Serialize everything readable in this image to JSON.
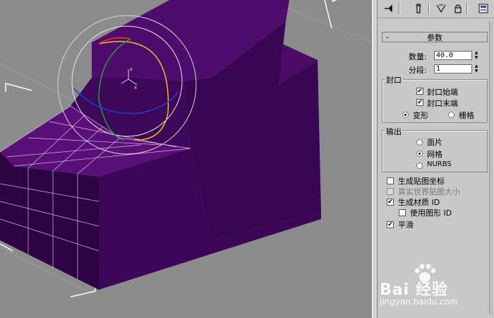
{
  "toolbar": {
    "icons": [
      "pin-icon",
      "stack-icon",
      "funnel-icon",
      "lock-icon",
      "configure-icon"
    ]
  },
  "rollout": {
    "collapse_symbol": "-",
    "title": "参数"
  },
  "params": {
    "amount_label": "数量:",
    "amount_value": "40.0",
    "segments_label": "分段:",
    "segments_value": "1"
  },
  "capping": {
    "title": "封口",
    "cap_start_label": "封口始端",
    "cap_start_checked": true,
    "cap_end_label": "封口末端",
    "cap_end_checked": true,
    "morph_label": "变形",
    "grid_label": "栅格",
    "selected": "morph"
  },
  "output": {
    "title": "输出",
    "patch_label": "面片",
    "mesh_label": "网格",
    "nurbs_label": "NURBS",
    "selected": "mesh"
  },
  "options": {
    "gen_map_coords_label": "生成贴图坐标",
    "gen_map_coords_checked": false,
    "real_world_label": "真实世界贴图大小",
    "real_world_checked": false,
    "gen_mat_id_label": "生成材质 ID",
    "gen_mat_id_checked": true,
    "use_shape_id_label": "使用图形 ID",
    "use_shape_id_checked": false,
    "smooth_label": "平滑",
    "smooth_checked": true
  },
  "watermark": {
    "brand": "Bai  经验",
    "url": "jingyan.baidu.com"
  },
  "colors": {
    "object_purple": "#4a0a66",
    "object_dark": "#2a0440",
    "object_side": "#3a0654",
    "viewport_bg": "#8c8c8c",
    "panel_bg": "#c8c8c8"
  }
}
